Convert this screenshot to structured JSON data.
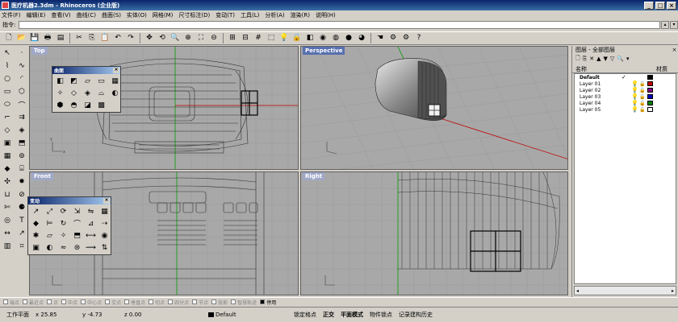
{
  "window": {
    "title": "医疗机器2.3dm - Rhinoceros (企业版)",
    "min_label": "_",
    "max_label": "□",
    "close_label": "×"
  },
  "menu": [
    "文件(F)",
    "编辑(E)",
    "查看(V)",
    "曲线(C)",
    "曲面(S)",
    "实体(O)",
    "网格(M)",
    "尺寸标注(D)",
    "变动(T)",
    "工具(L)",
    "分析(A)",
    "渲染(R)",
    "说明(H)"
  ],
  "command": {
    "label": "指令:",
    "value": ""
  },
  "toolbar_icons": [
    {
      "name": "new-file-icon",
      "glyph": "🗋"
    },
    {
      "name": "open-file-icon",
      "glyph": "📂"
    },
    {
      "name": "save-icon",
      "glyph": "💾"
    },
    {
      "name": "print-icon",
      "glyph": "🖶"
    },
    {
      "name": "properties-icon",
      "glyph": "▤"
    },
    {
      "name": "cut-icon",
      "glyph": "✂"
    },
    {
      "name": "copy-icon",
      "glyph": "⎘"
    },
    {
      "name": "paste-icon",
      "glyph": "📋"
    },
    {
      "name": "undo-icon",
      "glyph": "↶"
    },
    {
      "name": "redo-icon",
      "glyph": "↷"
    },
    {
      "name": "pan-icon",
      "glyph": "✥"
    },
    {
      "name": "rotate-view-icon",
      "glyph": "⟲"
    },
    {
      "name": "zoom-dynamic-icon",
      "glyph": "🔍"
    },
    {
      "name": "zoom-window-icon",
      "glyph": "⊕"
    },
    {
      "name": "zoom-extents-icon",
      "glyph": "⛶"
    },
    {
      "name": "zoom-selected-icon",
      "glyph": "⊖"
    },
    {
      "name": "four-viewports-icon",
      "glyph": "⊞"
    },
    {
      "name": "set-cplane-icon",
      "glyph": "⊟"
    },
    {
      "name": "grid-snap-icon",
      "glyph": "#"
    },
    {
      "name": "select-all-icon",
      "glyph": "⬚"
    },
    {
      "name": "light-bulb-icon",
      "glyph": "💡"
    },
    {
      "name": "lock-icon",
      "glyph": "🔒"
    },
    {
      "name": "layer-icon",
      "glyph": "◧"
    },
    {
      "name": "color-wheel-icon",
      "glyph": "◉"
    },
    {
      "name": "wireframe-sphere-icon",
      "glyph": "◍"
    },
    {
      "name": "shaded-sphere-icon",
      "glyph": "●"
    },
    {
      "name": "render-sphere-icon",
      "glyph": "◕"
    },
    {
      "name": "hand-icon",
      "glyph": "☚"
    },
    {
      "name": "settings-gear-icon",
      "glyph": "⚙"
    },
    {
      "name": "options-gear-icon",
      "glyph": "⚙"
    },
    {
      "name": "help-icon",
      "glyph": "?"
    }
  ],
  "left_tools": [
    {
      "name": "select-arrow-icon",
      "glyph": "↖"
    },
    {
      "name": "point-icon",
      "glyph": "·"
    },
    {
      "name": "polyline-icon",
      "glyph": "⌇"
    },
    {
      "name": "curve-icon",
      "glyph": "∿"
    },
    {
      "name": "circle-icon",
      "glyph": "○"
    },
    {
      "name": "arc-icon",
      "glyph": "◜"
    },
    {
      "name": "rectangle-icon",
      "glyph": "▭"
    },
    {
      "name": "polygon-icon",
      "glyph": "⬡"
    },
    {
      "name": "ellipse-icon",
      "glyph": "⬭"
    },
    {
      "name": "free-curve-icon",
      "glyph": "⌒"
    },
    {
      "name": "fillet-icon",
      "glyph": "⌐"
    },
    {
      "name": "offset-icon",
      "glyph": "⇉"
    },
    {
      "name": "surface-icon",
      "glyph": "◇"
    },
    {
      "name": "loft-icon",
      "glyph": "◈"
    },
    {
      "name": "box-icon",
      "glyph": "▣"
    },
    {
      "name": "extrude-icon",
      "glyph": "⬒"
    },
    {
      "name": "mesh-icon",
      "glyph": "▦"
    },
    {
      "name": "boolean-icon",
      "glyph": "⊚"
    },
    {
      "name": "color-box-icon",
      "glyph": "◆"
    },
    {
      "name": "cylinder-icon",
      "glyph": "⌸"
    },
    {
      "name": "move-icon",
      "glyph": "✣"
    },
    {
      "name": "explode-icon",
      "glyph": "✸"
    },
    {
      "name": "join-icon",
      "glyph": "⊔"
    },
    {
      "name": "split-icon",
      "glyph": "⊘"
    },
    {
      "name": "trim-icon",
      "glyph": "✄"
    },
    {
      "name": "spheres-icon",
      "glyph": "⚈"
    },
    {
      "name": "torus-icon",
      "glyph": "◎"
    },
    {
      "name": "text-icon",
      "glyph": "T"
    },
    {
      "name": "dimension-icon",
      "glyph": "↔"
    },
    {
      "name": "leader-icon",
      "glyph": "↗"
    },
    {
      "name": "block-icon",
      "glyph": "▥"
    },
    {
      "name": "analyze-icon",
      "glyph": "⌗"
    }
  ],
  "viewports": {
    "top": "Top",
    "perspective": "Perspective",
    "front": "Front",
    "right": "Right"
  },
  "palette_surface": {
    "title": "曲面",
    "close_label": "×",
    "icons": [
      {
        "name": "surface-corner-icon",
        "glyph": "◧"
      },
      {
        "name": "surface-edge-icon",
        "glyph": "◩"
      },
      {
        "name": "surface-plane-icon",
        "glyph": "▱"
      },
      {
        "name": "surface-extrude-icon",
        "glyph": "▭"
      },
      {
        "name": "surface-network-icon",
        "glyph": "▦"
      },
      {
        "name": "surface-sweep-icon",
        "glyph": "✧"
      },
      {
        "name": "surface-rail-icon",
        "glyph": "◇"
      },
      {
        "name": "surface-revolve-icon",
        "glyph": "◈"
      },
      {
        "name": "surface-loft-icon",
        "glyph": "⌓"
      },
      {
        "name": "surface-patch-icon",
        "glyph": "◐"
      },
      {
        "name": "surface-blend-icon",
        "glyph": "⬢"
      },
      {
        "name": "surface-offset-icon",
        "glyph": "◓"
      },
      {
        "name": "surface-fillet-icon",
        "glyph": "◪"
      },
      {
        "name": "surface-drape-icon",
        "glyph": "▩"
      }
    ]
  },
  "palette_transform": {
    "title": "变动",
    "close_label": "×",
    "icons": [
      {
        "name": "transform-move-icon",
        "glyph": "↗"
      },
      {
        "name": "transform-copy-icon",
        "glyph": "⤢"
      },
      {
        "name": "transform-rotate-icon",
        "glyph": "⟳"
      },
      {
        "name": "transform-scale-icon",
        "glyph": "⇲"
      },
      {
        "name": "transform-mirror-icon",
        "glyph": "⇋"
      },
      {
        "name": "transform-array-icon",
        "glyph": "▦"
      },
      {
        "name": "transform-orient-icon",
        "glyph": "◆"
      },
      {
        "name": "transform-align-icon",
        "glyph": "⊨"
      },
      {
        "name": "transform-twist-icon",
        "glyph": "↻"
      },
      {
        "name": "transform-bend-icon",
        "glyph": "⌒"
      },
      {
        "name": "transform-taper-icon",
        "glyph": "⊿"
      },
      {
        "name": "transform-flow-icon",
        "glyph": "⇢"
      },
      {
        "name": "transform-setpt-icon",
        "glyph": "✱"
      },
      {
        "name": "transform-shear-icon",
        "glyph": "▱"
      },
      {
        "name": "transform-smash-icon",
        "glyph": "✧"
      },
      {
        "name": "transform-project-icon",
        "glyph": "⬒"
      },
      {
        "name": "transform-stretch-icon",
        "glyph": "⟷"
      },
      {
        "name": "transform-splop-icon",
        "glyph": "◉"
      },
      {
        "name": "transform-cage-icon",
        "glyph": "▣"
      },
      {
        "name": "transform-sphere-icon",
        "glyph": "◐"
      },
      {
        "name": "transform-wave-icon",
        "glyph": "≈"
      },
      {
        "name": "transform-squish-icon",
        "glyph": "⊜"
      },
      {
        "name": "transform-unroll-icon",
        "glyph": "⟿"
      },
      {
        "name": "transform-flip-icon",
        "glyph": "⇅"
      }
    ]
  },
  "layer_panel": {
    "title": "图层 - 全部图层",
    "close_label": "×",
    "col_name": "名称",
    "col_material": "材质",
    "tools": [
      "🗋",
      "⎘",
      "✕",
      "▲",
      "▼",
      "▽",
      "🔍",
      "▾"
    ],
    "layers": [
      {
        "name": "Default",
        "current": true,
        "check": "✓",
        "bulb": "",
        "lock": "",
        "color": "#000000"
      },
      {
        "name": "Layer 01",
        "current": false,
        "check": "",
        "bulb": "💡",
        "lock": "🔓",
        "color": "#c00000"
      },
      {
        "name": "Layer 02",
        "current": false,
        "check": "",
        "bulb": "💡",
        "lock": "🔓",
        "color": "#800080"
      },
      {
        "name": "Layer 03",
        "current": false,
        "check": "",
        "bulb": "💡",
        "lock": "🔓",
        "color": "#0000c0"
      },
      {
        "name": "Layer 04",
        "current": false,
        "check": "",
        "bulb": "💡",
        "lock": "🔓",
        "color": "#008000"
      },
      {
        "name": "Layer 05",
        "current": false,
        "check": "",
        "bulb": "💡",
        "lock": "🔓",
        "color": "#ffffff"
      }
    ],
    "scroll_left": "◂",
    "scroll_right": "▸"
  },
  "osnaps": [
    {
      "label": "端点",
      "on": false
    },
    {
      "label": "最近点",
      "on": false
    },
    {
      "label": "点",
      "on": false
    },
    {
      "label": "中点",
      "on": false
    },
    {
      "label": "中心点",
      "on": false
    },
    {
      "label": "交点",
      "on": false
    },
    {
      "label": "垂直点",
      "on": false
    },
    {
      "label": "切点",
      "on": false
    },
    {
      "label": "四分点",
      "on": false
    },
    {
      "label": "节点",
      "on": false
    },
    {
      "label": "投影",
      "on": false
    },
    {
      "label": "智慧轨迹",
      "on": false
    },
    {
      "label": "停用",
      "on": true
    }
  ],
  "status": {
    "cplane": "工作平面",
    "x": "x 25.85",
    "y": "y -4.73",
    "z": "z 0.00",
    "layer": "Default",
    "lock_grid": "锁定格点",
    "ortho": "正交",
    "planar": "平面模式",
    "osnap": "物件锁点",
    "history": "记录建构历史"
  }
}
